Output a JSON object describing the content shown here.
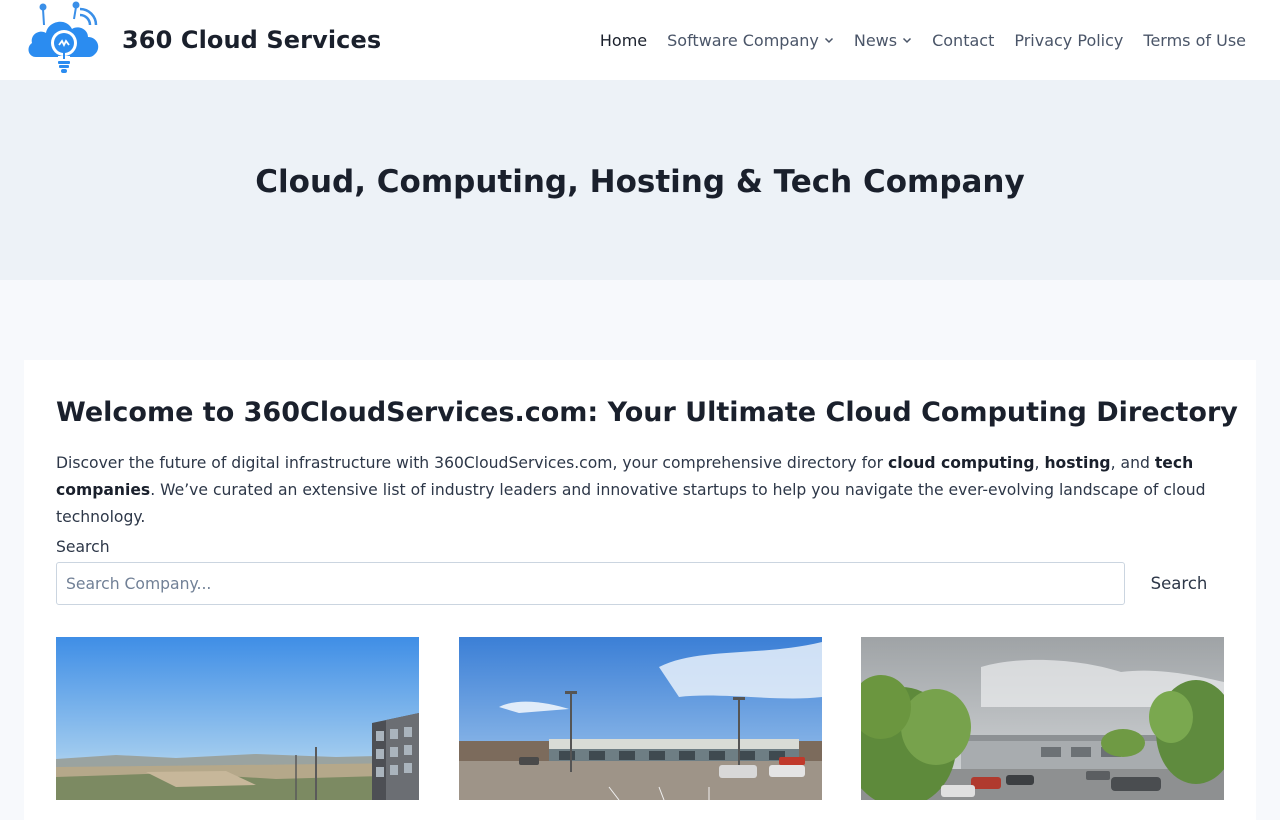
{
  "header": {
    "site_title": "360 Cloud Services",
    "logo_icon": "cloud-lightbulb-logo"
  },
  "nav": {
    "items": [
      {
        "label": "Home",
        "active": true,
        "has_dropdown": false
      },
      {
        "label": "Software Company",
        "active": false,
        "has_dropdown": true
      },
      {
        "label": "News",
        "active": false,
        "has_dropdown": true
      },
      {
        "label": "Contact",
        "active": false,
        "has_dropdown": false
      },
      {
        "label": "Privacy Policy",
        "active": false,
        "has_dropdown": false
      },
      {
        "label": "Terms of Use",
        "active": false,
        "has_dropdown": false
      }
    ]
  },
  "hero": {
    "title": "Cloud, Computing, Hosting & Tech Company"
  },
  "main": {
    "welcome_title": "Welcome to 360CloudServices.com: Your Ultimate Cloud Computing Directory",
    "intro": {
      "part1": "Discover the future of digital infrastructure with 360CloudServices.com, your comprehensive directory for ",
      "bold1": "cloud computing",
      "sep1": ", ",
      "bold2": "hosting",
      "sep2": ", and ",
      "bold3": "tech companies",
      "part2": ". We’ve curated an extensive list of industry leaders and innovative startups to help you navigate the ever-evolving landscape of cloud technology."
    },
    "search": {
      "label": "Search",
      "placeholder": "Search Company...",
      "value": "",
      "button_label": "Search"
    },
    "listings": [
      {
        "image": "office-building-sky-photo"
      },
      {
        "image": "strip-mall-parking-lot-photo"
      },
      {
        "image": "office-park-trees-photo"
      }
    ]
  },
  "colors": {
    "brand_blue": "#2b8cf0",
    "text_dark": "#1a202c",
    "text_muted": "#4a5568",
    "hero_bg": "#edf2f7",
    "page_bg": "#f7f9fc"
  }
}
